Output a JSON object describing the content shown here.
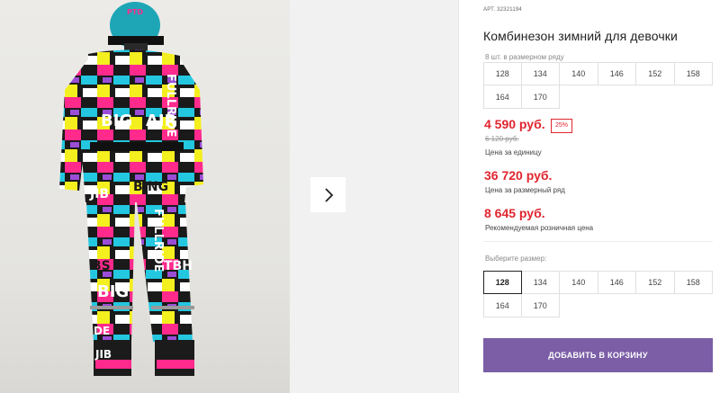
{
  "product": {
    "sku_prefix": "АРТ.",
    "sku": "32321194",
    "title": "Комбинезон зимний для девочки"
  },
  "pack": {
    "label": "8 шт. в размерном ряду",
    "sizes": [
      "128",
      "134",
      "140",
      "146",
      "152",
      "158",
      "164",
      "170"
    ]
  },
  "prices": {
    "unit_price": "4 590 руб.",
    "discount": "25%",
    "old_price": "6 120 руб.",
    "unit_caption": "Цена за единицу",
    "pack_price": "36 720 руб.",
    "pack_caption": "Цена за размерный ряд",
    "retail_price": "8 645 руб.",
    "retail_caption": "Рекомендуемая розничная цена"
  },
  "size_select": {
    "label": "Выберите размер:",
    "sizes": [
      "128",
      "134",
      "140",
      "146",
      "152",
      "158",
      "164",
      "170"
    ],
    "selected": "128"
  },
  "cart": {
    "button_label": "ДОБАВИТЬ В КОРЗИНУ"
  },
  "gallery": {
    "next_icon": "chevron-right-icon",
    "photo_print_words": [
      "BIG",
      "AIR",
      "FULLRIDE",
      "JIB",
      "BING",
      "BS",
      "TBH",
      "PTD",
      "DE"
    ]
  },
  "colors": {
    "price_red": "#e0252f",
    "button_purple": "#7b5ea6"
  }
}
